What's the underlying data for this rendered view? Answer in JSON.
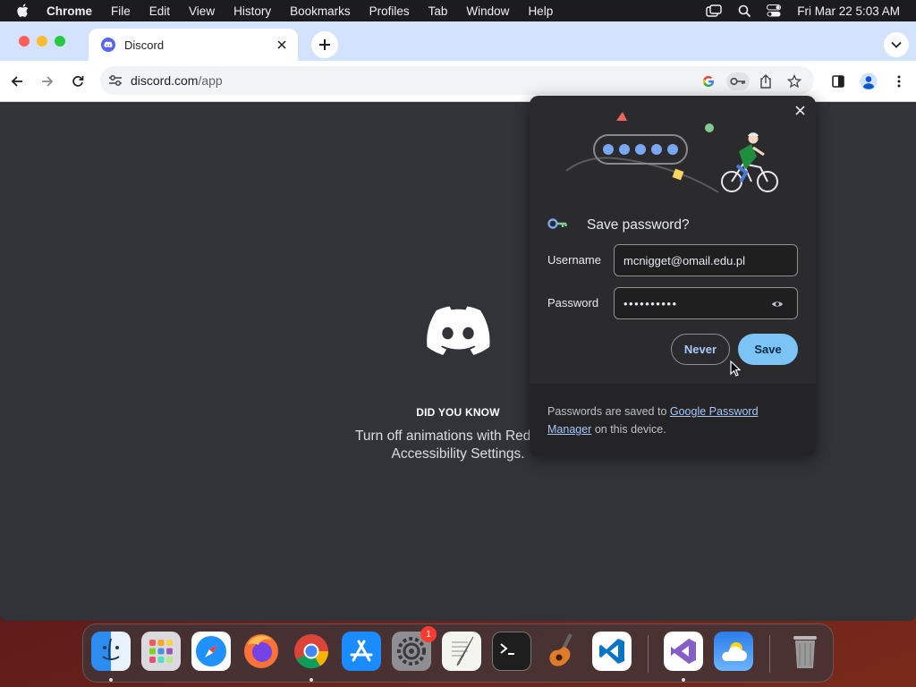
{
  "menubar": {
    "app_name": "Chrome",
    "menus": [
      "File",
      "Edit",
      "View",
      "History",
      "Bookmarks",
      "Profiles",
      "Tab",
      "Window",
      "Help"
    ],
    "clock": "Fri Mar 22  5:03 AM"
  },
  "tab": {
    "title": "Discord"
  },
  "omnibox": {
    "host": "discord.com",
    "path": "/app"
  },
  "page": {
    "dyk_title": "DID YOU KNOW",
    "dyk_text": "Turn off animations with Reduced Accessibility Settings."
  },
  "password_bubble": {
    "title": "Save password?",
    "username_label": "Username",
    "username_value": "mcnigget@omail.edu.pl",
    "password_label": "Password",
    "password_value": "••••••••••",
    "never_label": "Never",
    "save_label": "Save",
    "footer_prefix": "Passwords are saved to ",
    "footer_link": "Google Password Manager",
    "footer_suffix": " on this device."
  },
  "dock": {
    "apps": [
      "finder-icon",
      "launchpad-icon",
      "safari-icon",
      "firefox-icon",
      "chrome-icon",
      "app-store-icon",
      "system-settings-icon",
      "textedit-icon",
      "terminal-icon",
      "garageband-icon",
      "vscode-icon",
      "visual-studio-icon",
      "weather-icon",
      "trash-icon"
    ],
    "settings_badge": "1"
  },
  "colors": {
    "discord_bg": "#313338",
    "bubble_bg": "#2b2b2d",
    "save_button": "#7cc4f5",
    "link": "#a8c7fa",
    "tabstrip": "#d3e3fd"
  }
}
